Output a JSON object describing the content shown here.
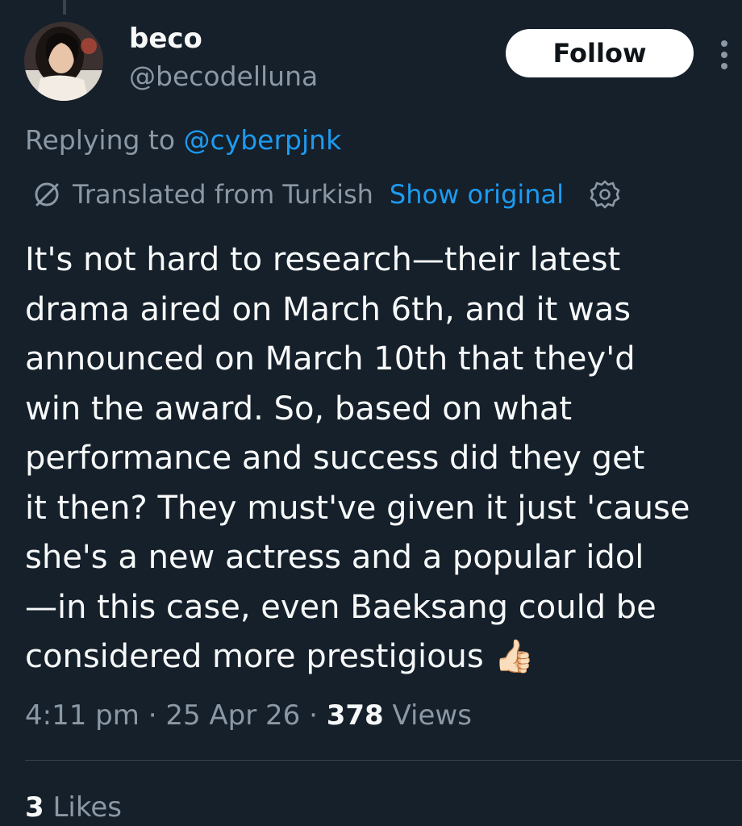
{
  "author": {
    "display_name": "beco",
    "handle": "@becodelluna",
    "avatar": "profile-photo-avatar"
  },
  "actions": {
    "follow_label": "Follow",
    "more_icon": "more-vertical-icon"
  },
  "reply": {
    "prefix": "Replying to",
    "mention": "@cyberpjnk"
  },
  "translation": {
    "icon": "translate-icon",
    "label": "Translated from Turkish",
    "show_original": "Show original",
    "settings_icon": "gear-icon"
  },
  "tweet": {
    "text": "It's not hard to research—their latest\ndrama aired on March 6th, and it was\nannounced on March 10th that they'd\nwin the award. So, based on what\nperformance and success did they get\nit then? They must've given it just 'cause\nshe's a new actress and a popular idol\n—in this case, even Baeksang could be\nconsidered more prestigious",
    "emoji": "👍🏻"
  },
  "meta": {
    "time": "4:11 pm",
    "separator": "·",
    "date": "25 Apr 26",
    "views_count": "378",
    "views_label": "Views"
  },
  "stats": {
    "likes_count": "3",
    "likes_label": "Likes"
  },
  "colors": {
    "background": "#15202b",
    "text": "#f7f9f9",
    "secondary": "#8b98a5",
    "accent": "#1d9bf0",
    "button_bg": "#ffffff",
    "divider": "#38444d"
  }
}
